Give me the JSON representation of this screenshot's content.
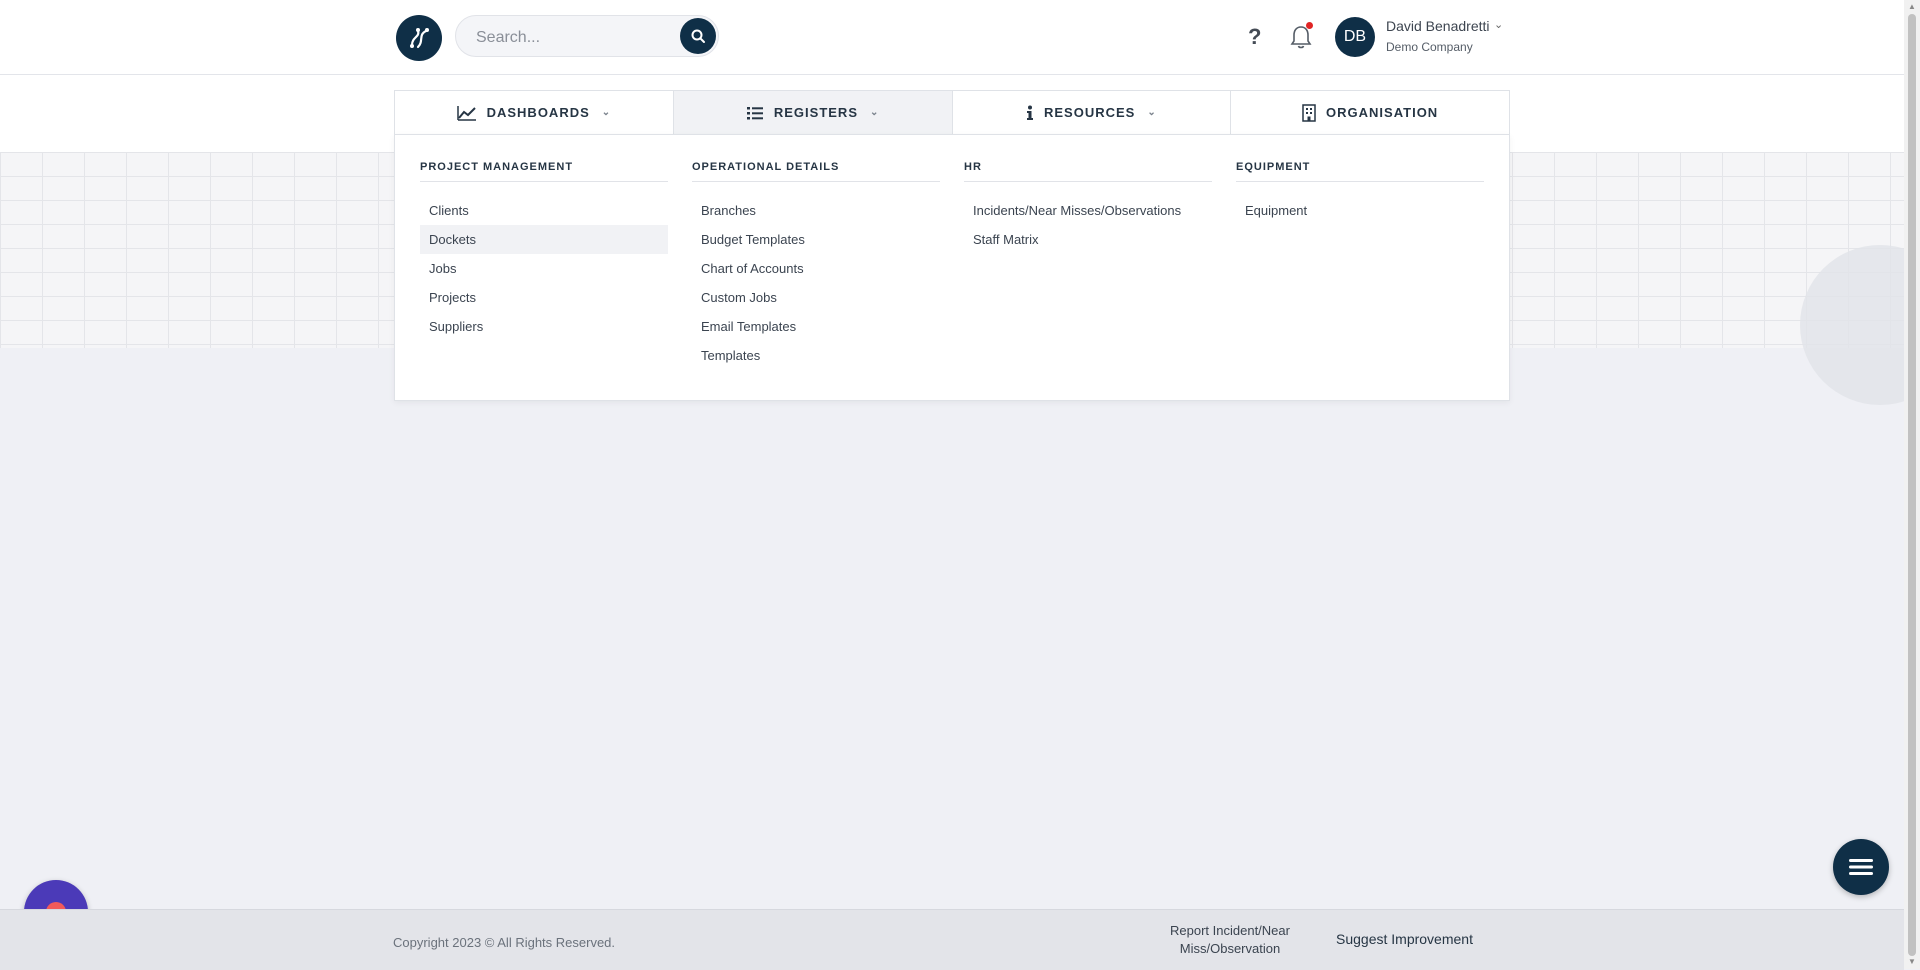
{
  "header": {
    "search_placeholder": "Search...",
    "help_label": "?",
    "user": {
      "initials": "DB",
      "name": "David Benadretti",
      "company": "Demo Company"
    }
  },
  "nav": {
    "items": [
      {
        "label": "DASHBOARDS",
        "icon": "line-chart-icon",
        "has_dropdown": true
      },
      {
        "label": "REGISTERS",
        "icon": "list-icon",
        "has_dropdown": true,
        "active": true
      },
      {
        "label": "RESOURCES",
        "icon": "info-icon",
        "has_dropdown": true
      },
      {
        "label": "ORGANISATION",
        "icon": "building-icon",
        "has_dropdown": false
      }
    ]
  },
  "menu": {
    "columns": [
      {
        "title": "PROJECT MANAGEMENT",
        "items": [
          "Clients",
          "Dockets",
          "Jobs",
          "Projects",
          "Suppliers"
        ]
      },
      {
        "title": "OPERATIONAL DETAILS",
        "items": [
          "Branches",
          "Budget Templates",
          "Chart of Accounts",
          "Custom Jobs",
          "Email Templates",
          "Templates"
        ]
      },
      {
        "title": "HR",
        "items": [
          "Incidents/Near Misses/Observations",
          "Staff Matrix"
        ]
      },
      {
        "title": "EQUIPMENT",
        "items": [
          "Equipment"
        ]
      }
    ],
    "hovered_item": "Dockets"
  },
  "footer": {
    "copyright": "Copyright 2023 © All Rights Reserved.",
    "report_line1": "Report Incident/Near",
    "report_line2": "Miss/Observation",
    "suggest": "Suggest Improvement"
  },
  "colors": {
    "brand": "#0f2f47",
    "record_button": "#4b3ab8",
    "notification_dot": "#e02424"
  }
}
